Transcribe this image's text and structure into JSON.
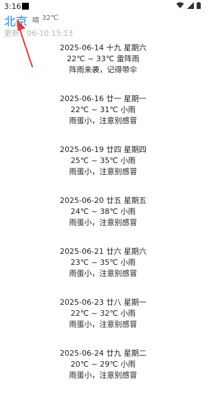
{
  "status_bar": {
    "time": "3:16"
  },
  "header": {
    "city": "北京",
    "condition": "晴",
    "temperature": "32℃"
  },
  "updated": {
    "label": "更新：",
    "value": "06-10 15:13"
  },
  "forecast": [
    {
      "date": "2025-06-14  十九   星期六",
      "temp": "22℃ ~ 33℃  雷阵雨",
      "tip": "阵雨来袭，记得带伞"
    },
    {
      "date": "2025-06-16  廿一   星期一",
      "temp": "22℃ ~ 31℃  小雨",
      "tip": "雨蛋小，注意别感冒"
    },
    {
      "date": "2025-06-19  廿四   星期四",
      "temp": "25℃ ~ 35℃  小雨",
      "tip": "雨蛋小，注意别感冒"
    },
    {
      "date": "2025-06-20  廿五   星期五",
      "temp": "24℃ ~ 38℃  小雨",
      "tip": "雨蛋小，注意别感冒"
    },
    {
      "date": "2025-06-21  廿六   星期六",
      "temp": "23℃ ~ 35℃  小雨",
      "tip": "雨蛋小，注意别感冒"
    },
    {
      "date": "2025-06-23  廿八   星期一",
      "temp": "22℃ ~ 32℃  小雨",
      "tip": "雨蛋小，注意别感冒"
    },
    {
      "date": "2025-06-24  廿九   星期二",
      "temp": "20℃ ~ 29℃  小雨",
      "tip": "雨蛋小，注意别感冒"
    }
  ],
  "colors": {
    "city": "#1e88e5",
    "arrow": "#e53935"
  }
}
